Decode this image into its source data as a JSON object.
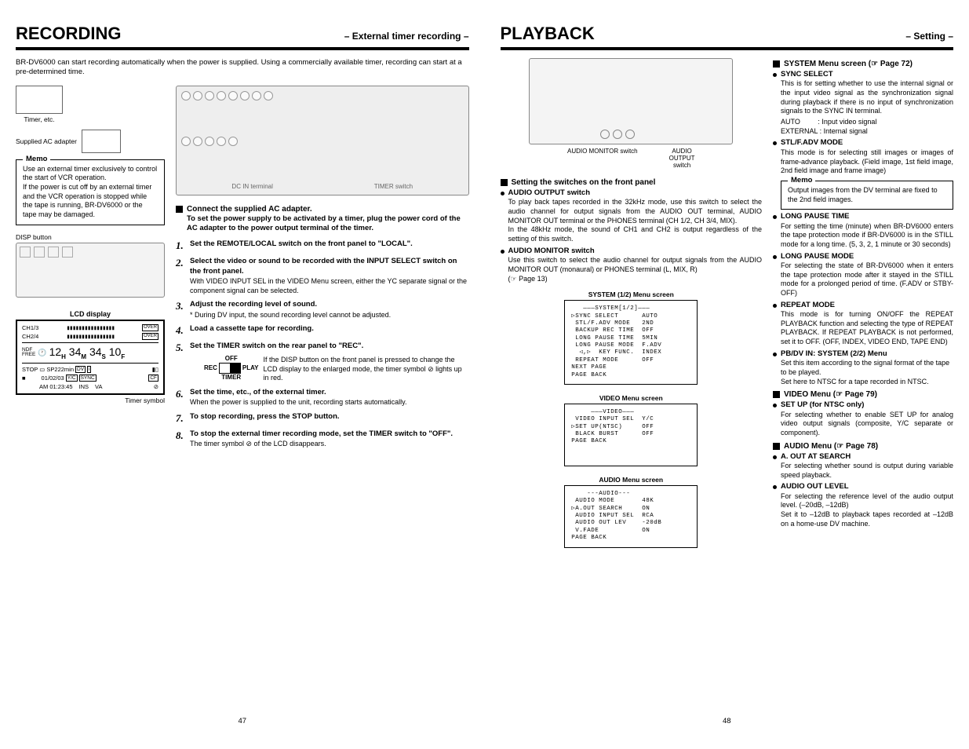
{
  "left": {
    "title": "RECORDING",
    "subtitle": "– External timer recording –",
    "intro": "BR-DV6000 can start recording automatically when the power is supplied. Using a commercially available timer, recording can start at a pre-determined time.",
    "diagram": {
      "timer_etc": "Timer, etc.",
      "supplied_adapter": "Supplied AC adapter",
      "dc_in": "DC IN terminal",
      "timer_switch": "TIMER switch"
    },
    "memo_title": "Memo",
    "memo_body": "Use an external timer exclusively to control the start of VCR operation.\nIf the power is cut off by an external timer and the VCR operation is stopped while the tape is running, BR-DV6000 or the tape may be damaged.",
    "disp_button": "DISP button",
    "lcd_caption": "LCD display",
    "lcd": {
      "ch13": "CH1/3",
      "ch24": "CH2/4",
      "over": "OVER",
      "tc_prefix": "NDF\nFREE",
      "tc": "12H 34M 34S 10F",
      "row_stop": "STOP",
      "row_sp": "SP222min",
      "row_date": "01/02/03",
      "row_yc": "Y/C",
      "row_sync": "SYNC",
      "row_am": "AM 01:23:45",
      "row_ins": "INS",
      "row_va": "VA"
    },
    "timer_symbol": "Timer symbol",
    "sec1": "Connect the supplied AC adapter.",
    "sec1b": "To set the power supply to be activated by a timer, plug the power cord of the AC adapter to the power output terminal of the timer.",
    "steps": [
      {
        "n": "1.",
        "b": "Set the REMOTE/LOCAL switch on the front panel to \"LOCAL\"."
      },
      {
        "n": "2.",
        "b": "Select the video or sound to be recorded with the INPUT SELECT switch on the front panel.",
        "note": "With VIDEO INPUT SEL in the VIDEO Menu screen, either the YC separate signal or the component signal can be selected."
      },
      {
        "n": "3.",
        "b": "Adjust the recording level of sound.",
        "note": "* During DV input, the sound recording level cannot be adjusted."
      },
      {
        "n": "4.",
        "b": "Load a cassette tape for recording."
      },
      {
        "n": "5.",
        "b": "Set the TIMER switch on the rear panel to \"REC\".",
        "sw": true,
        "sw_off": "OFF",
        "sw_rec": "REC",
        "sw_play": "PLAY",
        "sw_timer": "TIMER",
        "sw_note": "If the DISP button on the front panel is pressed to change the LCD display to the enlarged mode, the timer symbol ⊘ lights up in red."
      },
      {
        "n": "6.",
        "b": "Set the time, etc., of the external timer.",
        "note": "When the power is supplied to the unit, recording starts automatically."
      },
      {
        "n": "7.",
        "b": "To stop recording, press the STOP button."
      },
      {
        "n": "8.",
        "b": "To stop the external timer recording mode, set the TIMER switch to \"OFF\".",
        "note": "The timer symbol ⊘ of the LCD disappears."
      }
    ],
    "page": "47"
  },
  "right": {
    "title": "PLAYBACK",
    "subtitle": "– Setting –",
    "diagram": {
      "monitor": "AUDIO MONITOR switch",
      "output1": "AUDIO",
      "output2": "OUTPUT",
      "output3": "switch"
    },
    "sec_front": "Setting the switches on the front panel",
    "audio_output": {
      "t": "AUDIO OUTPUT switch",
      "d": "To play back tapes recorded in the 32kHz mode, use this switch to select the audio channel for output signals from the AUDIO OUT terminal, AUDIO MONITOR OUT terminal or the PHONES terminal (CH 1/2, CH 3/4, MIX).\nIn the 48kHz mode, the sound of CH1 and CH2 is output regardless of the setting of this switch."
    },
    "audio_monitor": {
      "t": "AUDIO MONITOR switch",
      "d": "Use this switch to select the audio channel for output signals from the AUDIO MONITOR OUT (monaural) or PHONES terminal (L, MIX, R)",
      "ref": "(☞ Page 13)"
    },
    "menu_sys_caption": "SYSTEM (1/2) Menu screen",
    "menu_sys": "   ———SYSTEM[1/2]———\n▷SYNC SELECT      AUTO\n STL/F.ADV MODE   2ND\n BACKUP REC TIME  OFF\n LONG PAUSE TIME  5MIN\n LONG PAUSE MODE  F.ADV\n  ◁,▷  KEY FUNC.  INDEX\n REPEAT MODE      OFF\nNEXT PAGE\nPAGE BACK",
    "menu_vid_caption": "VIDEO Menu screen",
    "menu_vid": "     ———VIDEO———\n VIDEO INPUT SEL  Y/C\n▷SET UP(NTSC)     OFF\n BLACK BURST      OFF\nPAGE BACK",
    "menu_aud_caption": "AUDIO Menu screen",
    "menu_aud": "    ---AUDIO---\n AUDIO MODE       48K\n▷A.OUT SEARCH     ON\n AUDIO INPUT SEL  RCA\n AUDIO OUT LEV    -20dB\n V.FADE           ON\nPAGE BACK",
    "sys_head": "SYSTEM Menu screen (☞ Page 72)",
    "items": [
      {
        "t": "SYNC SELECT",
        "d": "This is for setting whether to use the internal signal or the input video signal as the synchronization signal during playback if there is no input of synchronization signals to the SYNC IN terminal.",
        "extra": "AUTO         : Input video signal\nEXTERNAL : Internal signal"
      },
      {
        "t": "STL/F.ADV MODE",
        "d": "This mode is for selecting  still images or images of frame-advance playback. (Field image, 1st field image, 2nd field image and frame image)",
        "memo": "Output images from the DV terminal are fixed to the 2nd field images."
      },
      {
        "t": "LONG PAUSE TIME",
        "d": "For setting the time (minute) when BR-DV6000 enters the tape protection mode if BR-DV6000 is in the STILL mode for a long time. (5, 3, 2, 1 minute or 30 seconds)"
      },
      {
        "t": "LONG PAUSE MODE",
        "d": "For selecting the state of BR-DV6000 when it enters the tape protection mode after it stayed in the STILL mode for a prolonged period of time. (F.ADV or STBY-OFF)"
      },
      {
        "t": "REPEAT MODE",
        "d": "This mode is for turning ON/OFF the REPEAT PLAYBACK function and selecting the type of REPEAT PLAYBACK. If REPEAT PLAYBACK is not performed, set it to OFF. (OFF, INDEX, VIDEO END, TAPE END)"
      },
      {
        "t": "PB/DV IN: SYSTEM (2/2) Menu",
        "d": "Set this item according to the signal format of the tape to be played.\nSet here to NTSC for a tape recorded in NTSC."
      }
    ],
    "vid_head": "VIDEO Menu (☞ Page 79)",
    "vid_item": {
      "t": "SET UP (for NTSC only)",
      "d": "For selecting whether to enable SET UP for analog video output signals (composite, Y/C separate or component)."
    },
    "aud_head": "AUDIO Menu (☞ Page 78)",
    "aud_item1": {
      "t": "A. OUT AT SEARCH",
      "d": "For selecting whether sound is output during variable speed playback."
    },
    "aud_item2": {
      "t": "AUDIO OUT LEVEL",
      "d": "For selecting the reference level of the audio output level. (–20dB, –12dB)\nSet it to –12dB to playback tapes recorded at –12dB on a home-use DV machine."
    },
    "memo_title": "Memo",
    "page": "48"
  }
}
